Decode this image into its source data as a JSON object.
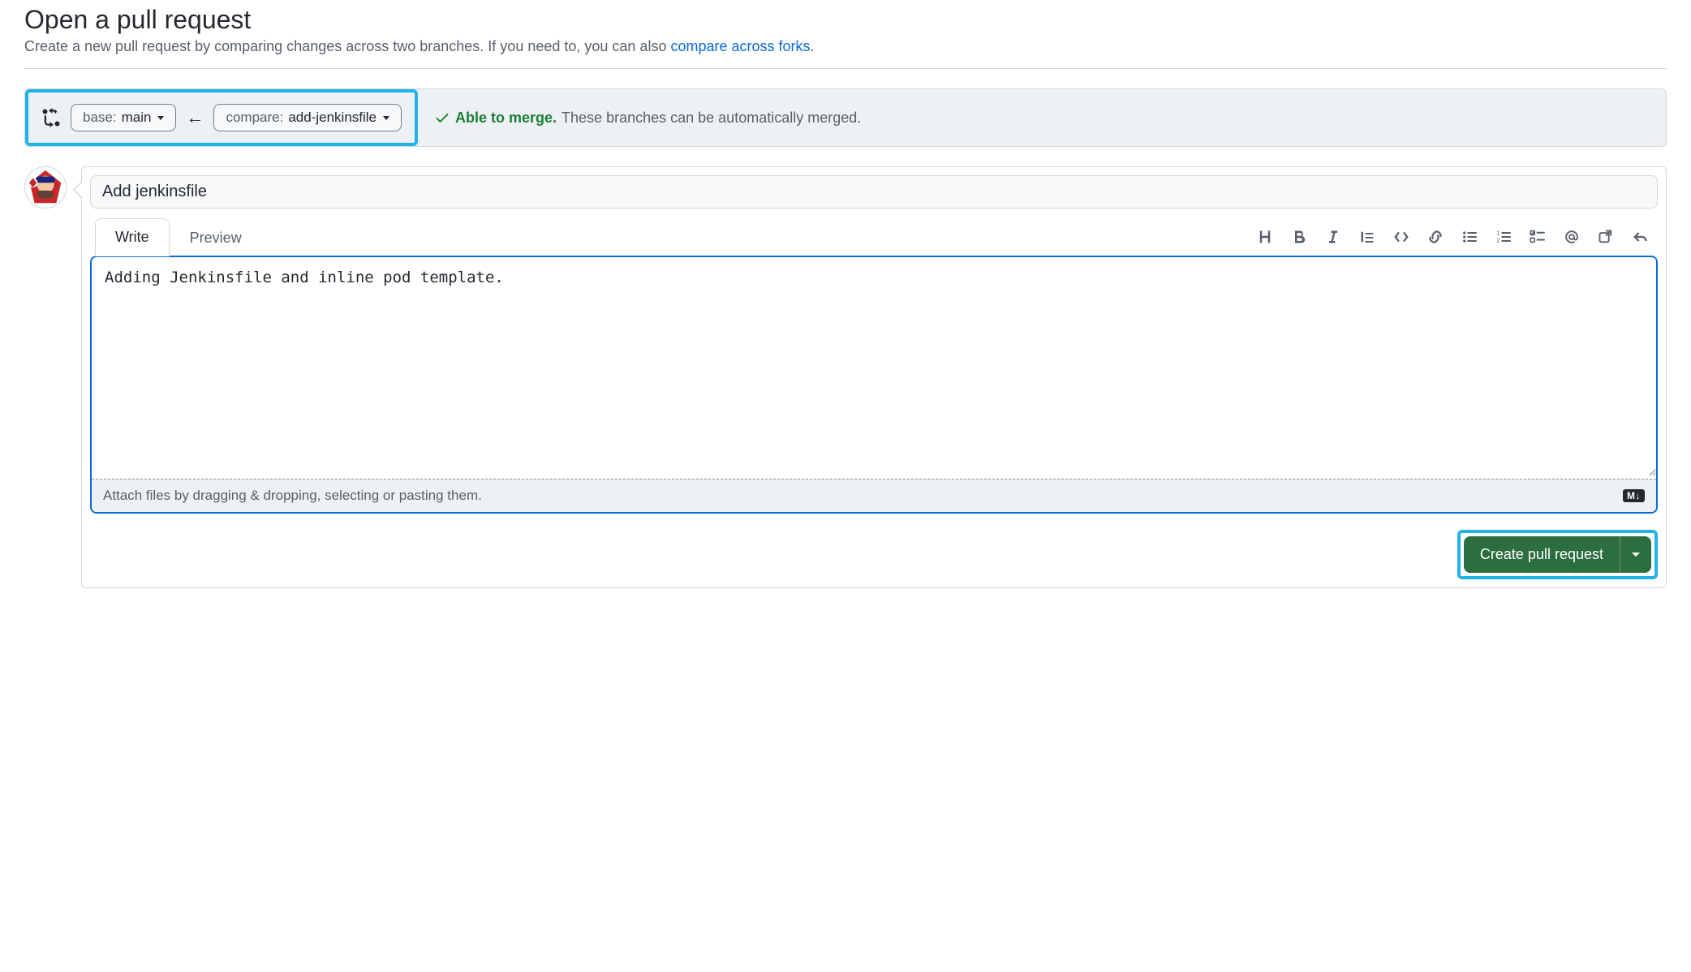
{
  "header": {
    "title": "Open a pull request",
    "subtitle_prefix": "Create a new pull request by comparing changes across two branches. If you need to, you can also ",
    "subtitle_link": "compare across forks",
    "subtitle_suffix": "."
  },
  "branches": {
    "base_label": "base:",
    "base_value": "main",
    "compare_label": "compare:",
    "compare_value": "add-jenkinsfile"
  },
  "merge_status": {
    "able": "Able to merge.",
    "desc": "These branches can be automatically merged."
  },
  "form": {
    "title_value": "Add jenkinsfile",
    "tabs": {
      "write": "Write",
      "preview": "Preview"
    },
    "body_value": "Adding Jenkinsfile and inline pod template.",
    "attach_text": "Attach files by dragging & dropping, selecting or pasting them.",
    "markdown_badge": "M↓"
  },
  "actions": {
    "create_label": "Create pull request"
  },
  "toolbar_icons": [
    "heading",
    "bold",
    "italic",
    "quote",
    "code",
    "link",
    "ul",
    "ol",
    "tasklist",
    "mention",
    "crossref",
    "reply"
  ]
}
